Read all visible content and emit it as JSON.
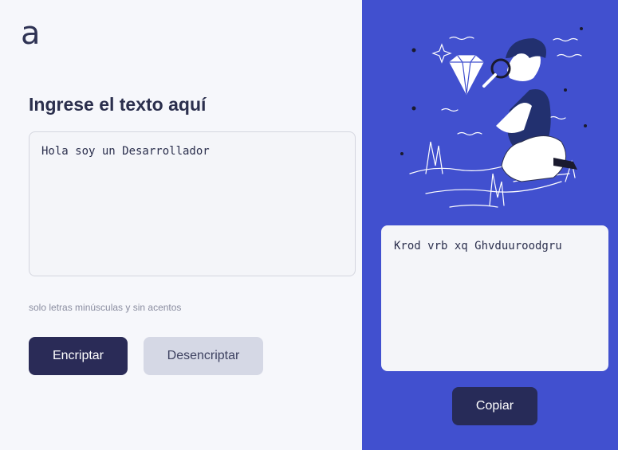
{
  "brand": {
    "logo_text": "a"
  },
  "input": {
    "heading": "Ingrese el texto aquí",
    "value": "Hola soy un Desarrollador",
    "hint": "solo letras minúsculas y sin acentos"
  },
  "buttons": {
    "encrypt_label": "Encriptar",
    "decrypt_label": "Desencriptar",
    "copy_label": "Copiar"
  },
  "output": {
    "value": "Krod vrb xq Ghvduuroodgru"
  },
  "colors": {
    "accent_panel": "#4150cf",
    "primary_button": "#2a2b57",
    "secondary_button": "#d5d8e5"
  }
}
